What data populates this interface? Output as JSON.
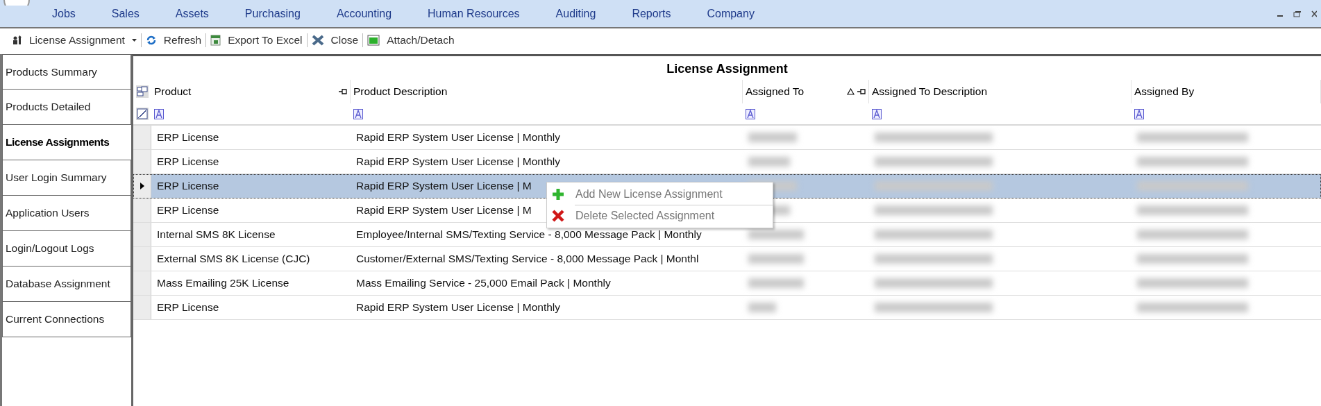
{
  "menu_bar": {
    "items": [
      "Jobs",
      "Sales",
      "Assets",
      "Purchasing",
      "Accounting",
      "Human Resources",
      "Auditing",
      "Reports",
      "Company"
    ]
  },
  "toolbar": {
    "items": [
      {
        "label": "License Assignment",
        "kind": "dropdown"
      },
      {
        "label": "Refresh",
        "kind": "button"
      },
      {
        "label": "Export To Excel",
        "kind": "button"
      },
      {
        "label": "Close",
        "kind": "button"
      },
      {
        "label": "Attach/Detach",
        "kind": "button"
      }
    ]
  },
  "sidebar": {
    "tabs": [
      {
        "label": "Products Summary",
        "selected": false
      },
      {
        "label": "Products Detailed",
        "selected": false
      },
      {
        "label": "License Assignments",
        "selected": true
      },
      {
        "label": "User Login Summary",
        "selected": false
      },
      {
        "label": "Application Users",
        "selected": false
      },
      {
        "label": "Login/Logout Logs",
        "selected": false
      },
      {
        "label": "Database Assignment",
        "selected": false
      },
      {
        "label": "Current Connections",
        "selected": false
      }
    ]
  },
  "grid": {
    "title": "License Assignment",
    "columns": [
      {
        "label": "Product",
        "pinned": true,
        "sorted": false
      },
      {
        "label": "Product Description",
        "pinned": false,
        "sorted": false
      },
      {
        "label": "Assigned To",
        "pinned": true,
        "sorted": true
      },
      {
        "label": "Assigned To Description",
        "pinned": false,
        "sorted": false
      },
      {
        "label": "Assigned By",
        "pinned": false,
        "sorted": false
      }
    ],
    "rows": [
      {
        "product": "ERP License",
        "description": "Rapid ERP System User License | Monthly",
        "selected": false
      },
      {
        "product": "ERP License",
        "description": "Rapid ERP System User License | Monthly",
        "selected": false
      },
      {
        "product": "ERP License",
        "description": "Rapid ERP System User License | M",
        "selected": true
      },
      {
        "product": "ERP License",
        "description": "Rapid ERP System User License | M",
        "selected": false
      },
      {
        "product": "Internal SMS 8K License",
        "description": "Employee/Internal SMS/Texting Service - 8,000 Message Pack | Monthly",
        "selected": false
      },
      {
        "product": "External SMS 8K License (CJC)",
        "description": "Customer/External SMS/Texting Service - 8,000 Message Pack | Monthl",
        "selected": false
      },
      {
        "product": "Mass Emailing 25K License",
        "description": "Mass Emailing Service - 25,000 Email Pack | Monthly",
        "selected": false
      },
      {
        "product": "ERP License",
        "description": "Rapid ERP System User License | Monthly",
        "selected": false
      }
    ]
  },
  "context_menu": {
    "items": [
      {
        "label": "Add New License Assignment",
        "kind": "add"
      },
      {
        "label": "Delete Selected Assignment",
        "kind": "delete"
      }
    ]
  }
}
